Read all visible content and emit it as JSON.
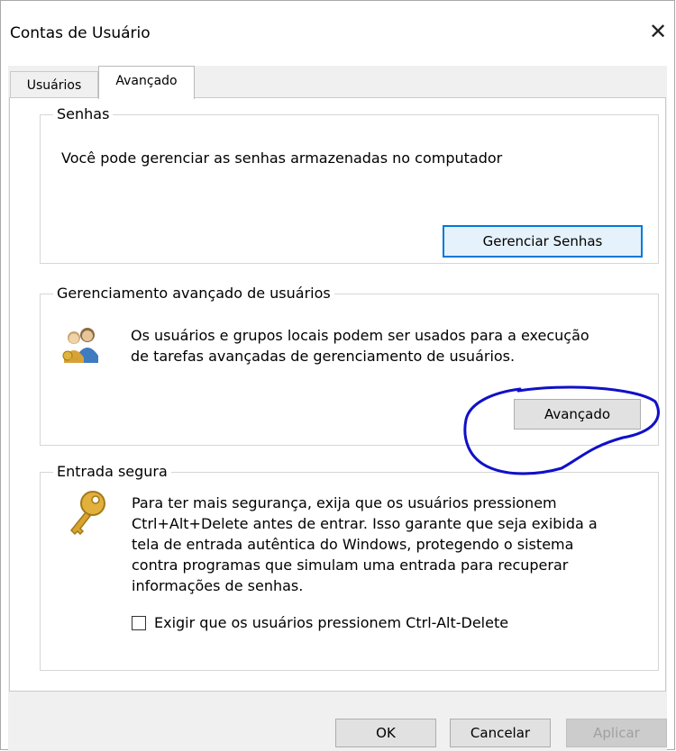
{
  "window": {
    "title": "Contas de Usuário",
    "close_symbol": "✕"
  },
  "tabs": [
    {
      "label": "Usuários",
      "active": false
    },
    {
      "label": "Avançado",
      "active": true
    }
  ],
  "passwords": {
    "group_label": "Senhas",
    "description": "Você pode gerenciar as senhas armazenadas no computador",
    "manage_button": "Gerenciar Senhas"
  },
  "advanced_user_management": {
    "group_label": "Gerenciamento avançado de usuários",
    "description_line1": "Os usuários e grupos locais podem ser usados para a execução",
    "description_line2": "de tarefas avançadas de gerenciamento de usuários.",
    "advanced_button": "Avançado",
    "icon": "users-group-icon"
  },
  "secure_logon": {
    "group_label": "Entrada segura",
    "description_lines": [
      "Para ter mais segurança, exija que os usuários pressionem",
      "Ctrl+Alt+Delete antes de entrar. Isso garante que seja exibida a",
      "tela de entrada autêntica do Windows, protegendo o sistema",
      "contra programas que simulam uma entrada para recuperar",
      "informações de senhas."
    ],
    "checkbox_label": "Exigir que os usuários pressionem Ctrl-Alt-Delete",
    "checkbox_checked": false,
    "icon": "key-icon"
  },
  "footer": {
    "ok": "OK",
    "cancel": "Cancelar",
    "apply": "Aplicar"
  },
  "colors": {
    "annotation": "#1010c8",
    "focus_border": "#0078d7"
  }
}
